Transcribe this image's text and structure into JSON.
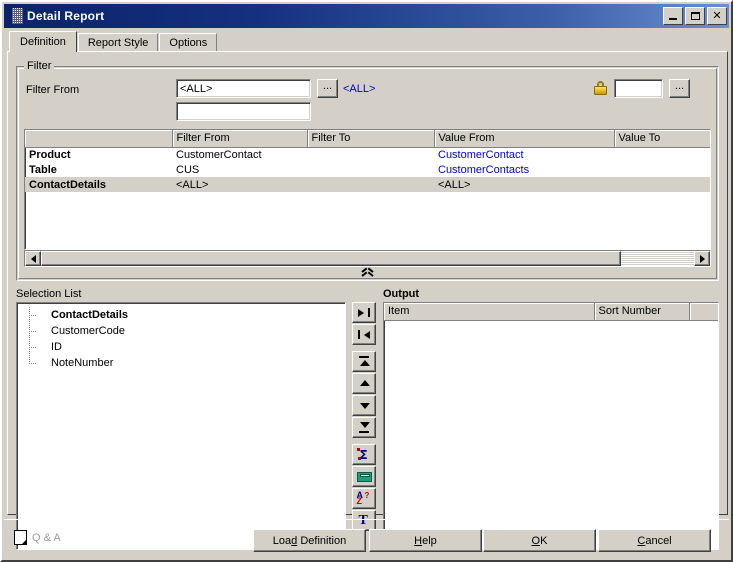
{
  "window": {
    "title": "Detail Report",
    "app_icon": "report-icon",
    "controls": {
      "minimize": "minimize-icon",
      "maximize": "maximize-icon",
      "close": "✕"
    }
  },
  "tabs": [
    {
      "label": "Definition",
      "active": true
    },
    {
      "label": "Report Style",
      "active": false
    },
    {
      "label": "Options",
      "active": false
    }
  ],
  "filter": {
    "group_title": "Filter",
    "label": "Filter From",
    "input_primary": {
      "value": "<ALL>",
      "placeholder": ""
    },
    "input_secondary": {
      "value": "",
      "placeholder": ""
    },
    "ellipsis_label": "...",
    "link_all": "<ALL>",
    "lock_icon": "lock-icon",
    "secure_input": {
      "value": "",
      "placeholder": ""
    },
    "secure_ellipsis_label": "..."
  },
  "grid": {
    "columns": [
      "",
      "Filter From",
      "Filter To",
      "Value From",
      "Value To"
    ],
    "rows": [
      {
        "name": "Product",
        "filter_from": "CustomerContact",
        "filter_to": "",
        "value_from": "CustomerContact",
        "value_to": "",
        "selected": false
      },
      {
        "name": "Table",
        "filter_from": "CUS",
        "filter_to": "",
        "value_from": "CustomerContacts",
        "value_to": "",
        "selected": false
      },
      {
        "name": "ContactDetails",
        "filter_from": "<ALL>",
        "filter_to": "",
        "value_from": "<ALL>",
        "value_to": "",
        "selected": true
      }
    ],
    "scroll_left_icon": "scroll-left-arrow-icon",
    "scroll_right_icon": "scroll-right-arrow-icon",
    "collapse_icon": "chevron-double-up-icon"
  },
  "selection_list": {
    "label": "Selection List",
    "nodes": [
      {
        "label": "ContactDetails",
        "bold": true,
        "last": false
      },
      {
        "label": "CustomerCode",
        "bold": false,
        "last": false
      },
      {
        "label": "ID",
        "bold": false,
        "last": false
      },
      {
        "label": "NoteNumber",
        "bold": false,
        "last": true
      }
    ]
  },
  "transfer_buttons": [
    {
      "name": "move-right-button",
      "icon": "arrow-right-bar-icon"
    },
    {
      "name": "move-left-button",
      "icon": "arrow-left-bar-icon"
    },
    {
      "name": "move-top-button",
      "icon": "arrow-up-top-icon"
    },
    {
      "name": "move-up-button",
      "icon": "arrow-up-icon"
    },
    {
      "name": "move-down-button",
      "icon": "arrow-down-icon"
    },
    {
      "name": "move-bottom-button",
      "icon": "arrow-down-bottom-icon"
    },
    {
      "name": "total-button",
      "icon": "sigma-total-icon"
    },
    {
      "name": "calculate-button",
      "icon": "calculator-icon"
    },
    {
      "name": "sort-button",
      "icon": "sort-az-icon"
    },
    {
      "name": "filter-button",
      "icon": "funnel-filter-icon"
    }
  ],
  "output": {
    "label": "Output",
    "columns": [
      "Item",
      "Sort Number",
      ""
    ],
    "rows": []
  },
  "footer": {
    "qa_label": "Q & A",
    "qa_icon": "page-icon",
    "buttons": [
      {
        "label": "Load Definition",
        "accel": "D",
        "name": "load-definition-button"
      },
      {
        "label": "Help",
        "accel": "H",
        "name": "help-button"
      },
      {
        "label": "OK",
        "accel": "O",
        "name": "ok-button"
      },
      {
        "label": "Cancel",
        "accel": "C",
        "name": "cancel-button"
      }
    ]
  },
  "colors": {
    "face": "#d4d0c8",
    "title_start": "#0a246a",
    "title_end": "#6b8fd0",
    "link": "#0000cd",
    "selection": "#d4d0c8"
  }
}
